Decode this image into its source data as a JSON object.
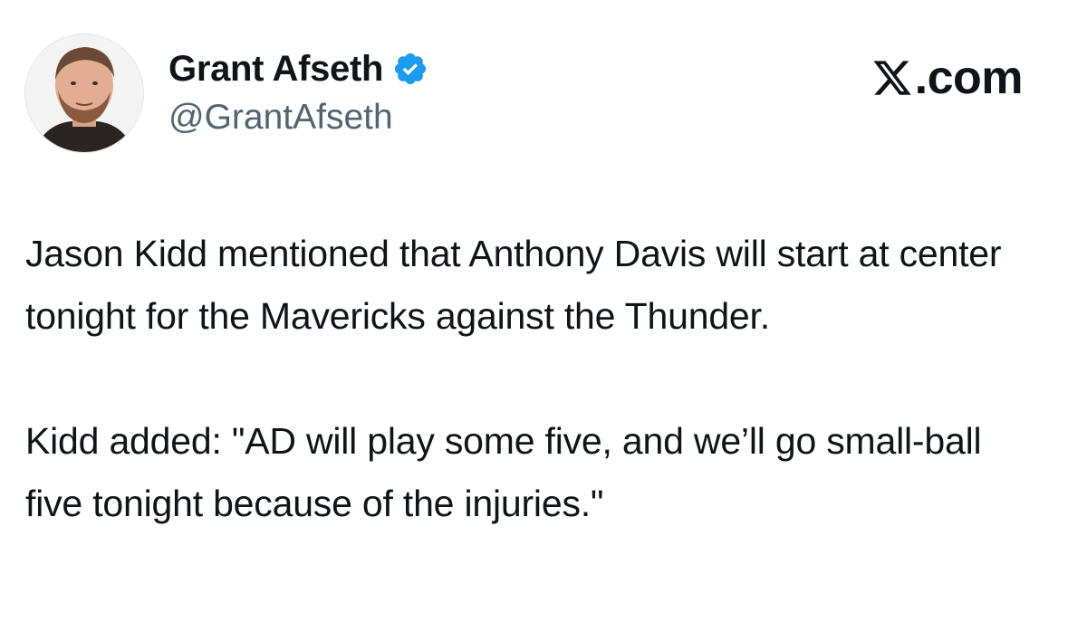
{
  "author": {
    "display_name": "Grant Afseth",
    "handle": "@GrantAfseth",
    "verified_icon": "verified-badge-icon",
    "avatar_icon": "avatar-photo"
  },
  "brand": {
    "text": ".com",
    "logo_icon": "x-logo-icon"
  },
  "tweet": {
    "paragraphs": [
      "Jason Kidd mentioned that Anthony Davis will start at center tonight for the Mavericks against the Thunder.",
      "Kidd added: \"AD will play some five, and we’ll go small-ball five tonight because of the injuries.\""
    ]
  },
  "colors": {
    "text_primary": "#0f1419",
    "text_secondary": "#536471",
    "verified_blue": "#1d9bf0",
    "background": "#ffffff"
  }
}
